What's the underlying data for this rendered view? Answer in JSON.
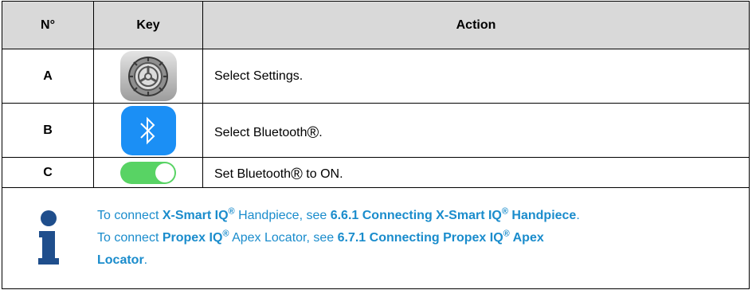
{
  "table": {
    "headers": {
      "num": "N°",
      "key": "Key",
      "action": "Action"
    },
    "rows": [
      {
        "id": "A",
        "action": "Select Settings.",
        "icon": "settings-gear-icon"
      },
      {
        "id": "B",
        "action_pre": "Select Bluetooth",
        "action_post": ".",
        "icon": "bluetooth-icon"
      },
      {
        "id": "C",
        "action_pre": "Set Bluetooth",
        "action_post": " to ON.",
        "icon": "toggle-on-icon"
      }
    ],
    "reg": "®"
  },
  "note": {
    "l1_a": "To connect ",
    "l1_b": "X-Smart IQ",
    "l1_c": " Handpiece, see ",
    "l1_d": "6.6.1 Connecting X-Smart IQ",
    "l1_e": " Handpiece",
    "l1_f": ".",
    "l2_a": "To connect ",
    "l2_b": "Propex IQ",
    "l2_c": " Apex Locator, see ",
    "l2_d": "6.7.1 Connecting Propex IQ",
    "l2_e": " Apex",
    "l3_a": "Locator",
    "l3_b": ".",
    "reg": "®",
    "icon": "info-icon",
    "color": "#1a8ccc"
  },
  "colors": {
    "header_bg": "#d9d9d9",
    "bluetooth": "#1b8ff5",
    "toggle": "#58d364"
  }
}
